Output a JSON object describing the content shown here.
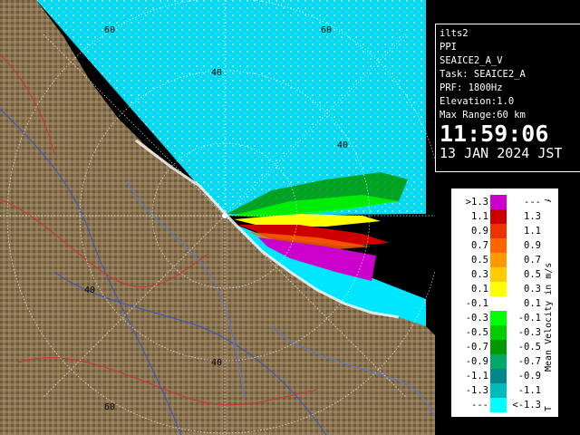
{
  "info": {
    "station": "ilts2",
    "product": "PPI",
    "volume": "SEAICE2_A_V",
    "task": "Task: SEAICE2_A",
    "prf": "PRF: 1800Hz",
    "elevation": "Elevation:1.0",
    "max_range": "Max Range:60 km",
    "time": "11:59:06",
    "date": "13 JAN 2024 JST"
  },
  "legend": {
    "title": "Mean Velocity in m/s",
    "top_marker": "A",
    "bottom_marker": "T",
    "rows": [
      {
        "lo": ">1.3",
        "hi": "---",
        "color": "#cc00cc"
      },
      {
        "lo": "1.1",
        "hi": "1.3",
        "color": "#cc0000"
      },
      {
        "lo": "0.9",
        "hi": "1.1",
        "color": "#ee3300"
      },
      {
        "lo": "0.7",
        "hi": "0.9",
        "color": "#ff6600"
      },
      {
        "lo": "0.5",
        "hi": "0.7",
        "color": "#ff9900"
      },
      {
        "lo": "0.3",
        "hi": "0.5",
        "color": "#ffcc00"
      },
      {
        "lo": "0.1",
        "hi": "0.3",
        "color": "#ffff00"
      },
      {
        "lo": "-0.1",
        "hi": "0.1",
        "color": "#ffffff"
      },
      {
        "lo": "-0.3",
        "hi": "-0.1",
        "color": "#00ff00"
      },
      {
        "lo": "-0.5",
        "hi": "-0.3",
        "color": "#00cc00"
      },
      {
        "lo": "-0.7",
        "hi": "-0.5",
        "color": "#009900"
      },
      {
        "lo": "-0.9",
        "hi": "-0.7",
        "color": "#00aa66"
      },
      {
        "lo": "-1.1",
        "hi": "-0.9",
        "color": "#008888"
      },
      {
        "lo": "-1.3",
        "hi": "-1.1",
        "color": "#00bbbb"
      },
      {
        "lo": "---",
        "hi": "<-1.3",
        "color": "#00ffff"
      }
    ]
  },
  "map": {
    "range_ring_labels": [
      "40",
      "40",
      "40",
      "40",
      "60",
      "60",
      "60"
    ],
    "colors": {
      "land": "#8a7452",
      "sea_echo": "#00e6ff",
      "background": "#000000"
    }
  }
}
